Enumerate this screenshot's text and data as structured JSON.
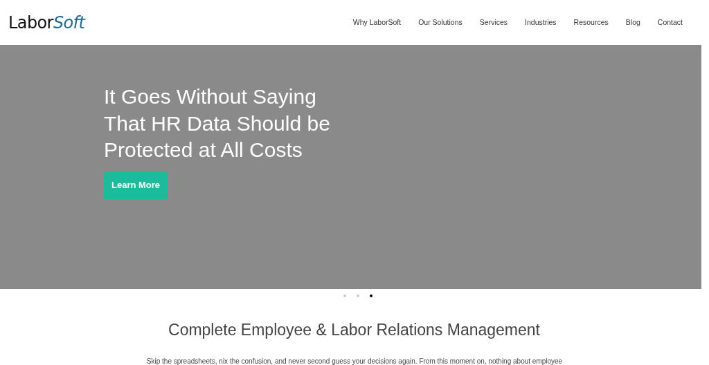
{
  "header": {
    "logo": {
      "main": "Labor",
      "accent": "Soft"
    },
    "nav": [
      {
        "label": "Why LaborSoft"
      },
      {
        "label": "Our Solutions"
      },
      {
        "label": "Services"
      },
      {
        "label": "Industries"
      },
      {
        "label": "Resources"
      },
      {
        "label": "Blog"
      },
      {
        "label": "Contact"
      }
    ]
  },
  "hero": {
    "title_lines": [
      "It Goes Without Saying",
      "That HR Data Should be",
      "Protected at All Costs"
    ],
    "button": "Learn More"
  },
  "carousel_dots": [
    {
      "selected": false
    },
    {
      "selected": false
    },
    {
      "selected": true
    }
  ],
  "section": {
    "heading": "Complete Employee & Labor Relations Management",
    "text": "Skip the spreadsheets, nix the confusion, and never second guess your decisions again. From this moment on, nothing about employee"
  }
}
